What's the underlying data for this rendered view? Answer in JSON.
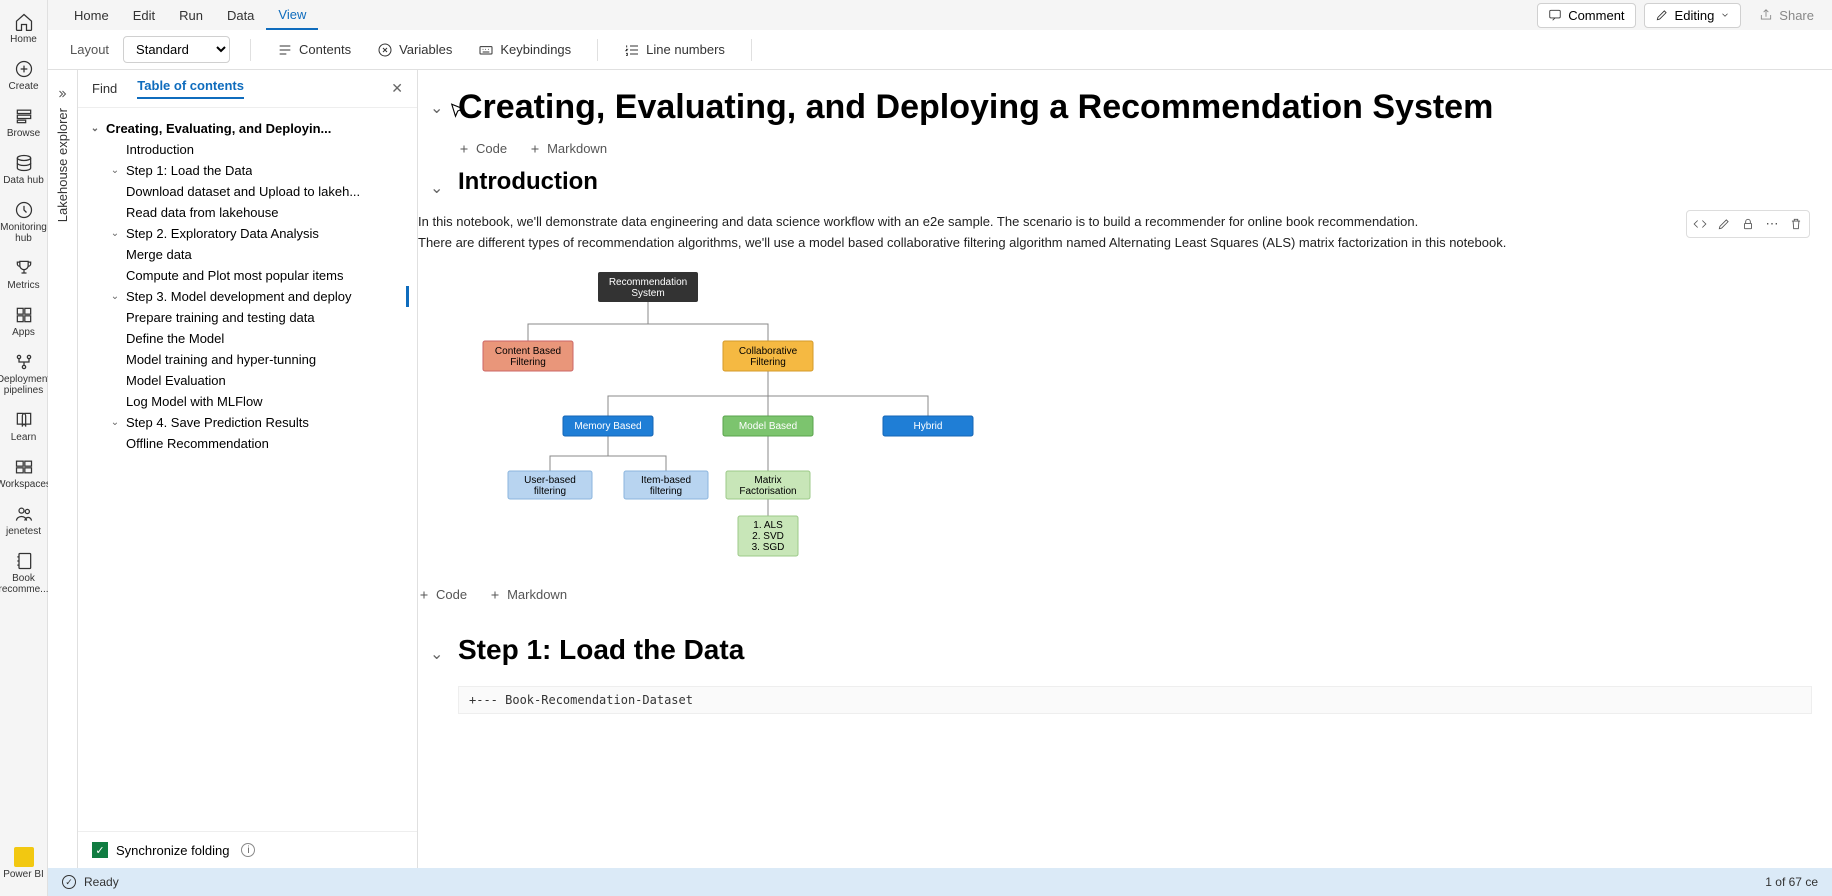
{
  "nav_rail": {
    "items": [
      {
        "label": "Home"
      },
      {
        "label": "Create"
      },
      {
        "label": "Browse"
      },
      {
        "label": "Data hub"
      },
      {
        "label": "Monitoring hub"
      },
      {
        "label": "Metrics"
      },
      {
        "label": "Apps"
      },
      {
        "label": "Deployment pipelines"
      },
      {
        "label": "Learn"
      },
      {
        "label": "Workspaces"
      },
      {
        "label": "jenetest"
      },
      {
        "label": "Book recomme..."
      }
    ],
    "bottom_label": "Power BI"
  },
  "menu": {
    "tabs": [
      "Home",
      "Edit",
      "Run",
      "Data",
      "View"
    ],
    "active": "View",
    "comment": "Comment",
    "editing": "Editing",
    "share": "Share"
  },
  "toolbar": {
    "layout_label": "Layout",
    "layout_value": "Standard",
    "contents": "Contents",
    "variables": "Variables",
    "keybindings": "Keybindings",
    "linenumbers": "Line numbers"
  },
  "lakehouse_tab": "Lakehouse explorer",
  "toc": {
    "find": "Find",
    "title": "Table of contents",
    "root": "Creating, Evaluating, and Deployin...",
    "items": [
      {
        "indent": 1,
        "label": "Introduction"
      },
      {
        "indent": 1,
        "chev": true,
        "label": "Step 1: Load the Data"
      },
      {
        "indent": 2,
        "label": "Download dataset and Upload to lakeh..."
      },
      {
        "indent": 2,
        "label": "Read data from lakehouse"
      },
      {
        "indent": 1,
        "chev": true,
        "label": "Step 2. Exploratory Data Analysis"
      },
      {
        "indent": 2,
        "label": "Merge data"
      },
      {
        "indent": 2,
        "label": "Compute and Plot most popular items"
      },
      {
        "indent": 1,
        "chev": true,
        "label": "Step 3. Model development and deploy"
      },
      {
        "indent": 2,
        "label": "Prepare training and testing data"
      },
      {
        "indent": 2,
        "label": "Define the Model"
      },
      {
        "indent": 2,
        "label": "Model training and hyper-tunning"
      },
      {
        "indent": 2,
        "label": "Model Evaluation"
      },
      {
        "indent": 2,
        "label": "Log Model with MLFlow"
      },
      {
        "indent": 1,
        "chev": true,
        "label": "Step 4. Save Prediction Results"
      },
      {
        "indent": 2,
        "label": "Offline Recommendation"
      }
    ],
    "sync": "Synchronize folding"
  },
  "notebook": {
    "title_h1": "Creating, Evaluating, and Deploying a Recommendation System",
    "add_code": "Code",
    "add_md": "Markdown",
    "intro_h2": "Introduction",
    "intro_p1": "In this notebook, we'll demonstrate data engineering and data science workflow with an e2e sample. The scenario is to build a recommender for online book recommendation.",
    "intro_p2": "There are different types of recommendation algorithms, we'll use a model based collaborative filtering algorithm named Alternating Least Squares (ALS) matrix factorization in this notebook.",
    "diagram": {
      "root": "Recommendation System",
      "cbf": "Content Based Filtering",
      "cf": "Collaborative Filtering",
      "mem": "Memory Based",
      "model": "Model Based",
      "hybrid": "Hybrid",
      "user": "User-based filtering",
      "item": "Item-based filtering",
      "matrix": "Matrix Factorisation",
      "algos": "1. ALS\n2. SVD\n3. SGD"
    },
    "step1_h2": "Step 1: Load the Data",
    "code_line": "+--- Book-Recomendation-Dataset"
  },
  "status": {
    "ready": "Ready",
    "right": "1 of 67 ce"
  }
}
